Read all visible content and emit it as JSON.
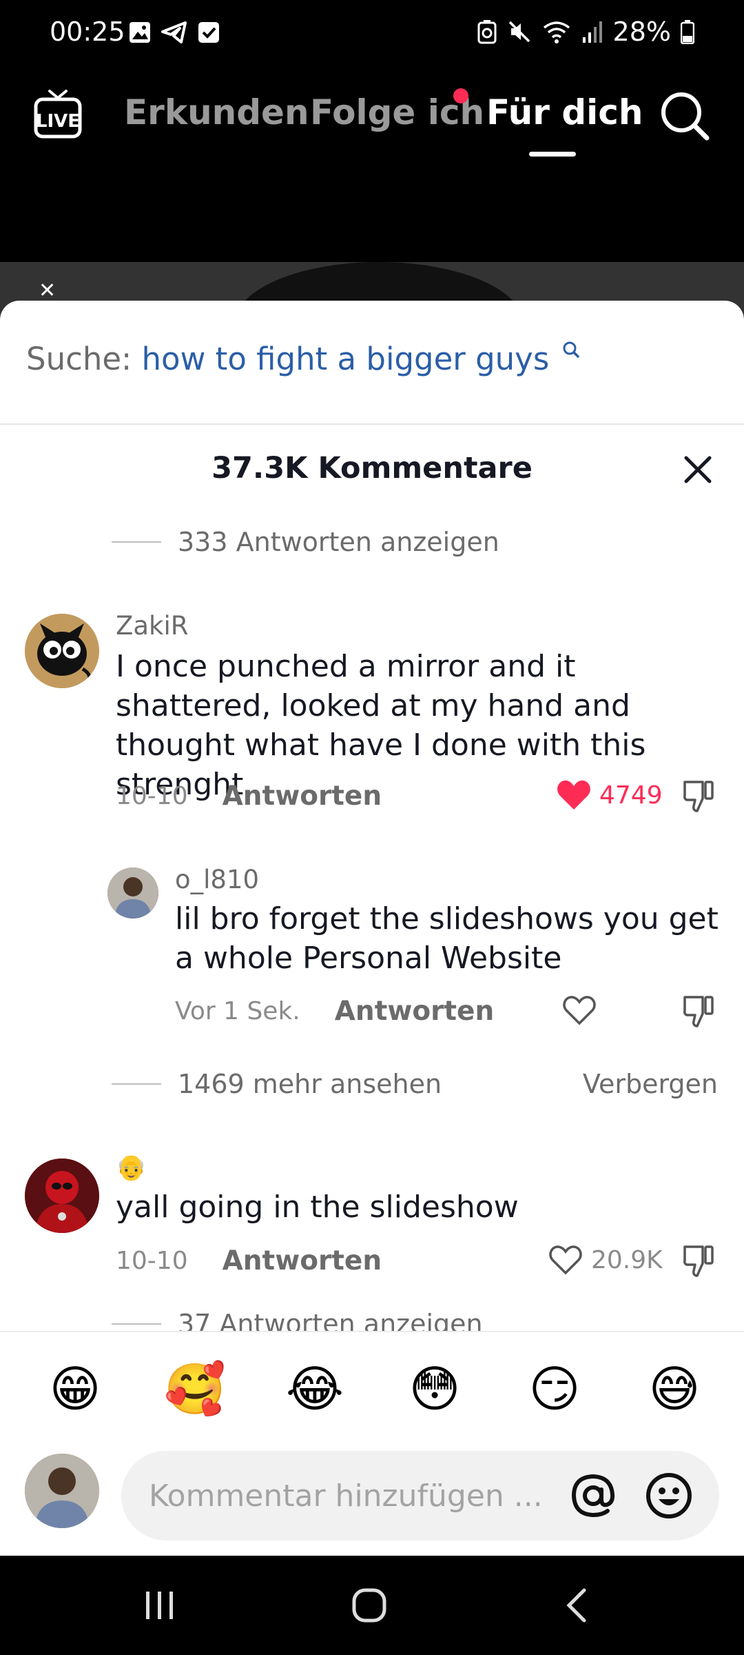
{
  "status_bar": {
    "time": "00:25",
    "battery": "28%"
  },
  "top_nav": {
    "live_label": "LIVE",
    "tabs": [
      {
        "label": "Erkunden"
      },
      {
        "label": "Folge ich"
      },
      {
        "label": "Für dich"
      }
    ],
    "active_tab": "Für dich"
  },
  "comments_sheet": {
    "search_prefix": "Suche:",
    "search_term": "how to fight a bigger guys",
    "title": "37.3K Kommentare",
    "top_replies_link": "333 Antworten anzeigen",
    "comments": [
      {
        "username": "ZakiR",
        "text": "I once punched a mirror and it shattered, looked at my hand and thought what have I done with this strenght",
        "date": "10-10",
        "reply_label": "Antworten",
        "likes": "4749",
        "liked": true
      },
      {
        "username": "o_l810",
        "text": "lil bro forget the slideshows you get a whole Personal Website",
        "date": "Vor 1 Sek.",
        "reply_label": "Antworten",
        "likes": "",
        "liked": false
      },
      {
        "username": "",
        "username_emoji": "👴",
        "text": "yall going in the slideshow",
        "date": "10-10",
        "reply_label": "Antworten",
        "likes": "20.9K",
        "liked": false
      }
    ],
    "more_link": "1469 mehr ansehen",
    "hide_link": "Verbergen",
    "bottom_replies_link": "37 Antworten anzeigen"
  },
  "input_area": {
    "quick_emojis": [
      "😁",
      "🥰",
      "😂",
      "😳",
      "😏",
      "😅"
    ],
    "placeholder": "Kommentar hinzufügen ..."
  },
  "colors": {
    "accent_like": "#fe2c55",
    "link_blue": "#2b5ea8"
  }
}
